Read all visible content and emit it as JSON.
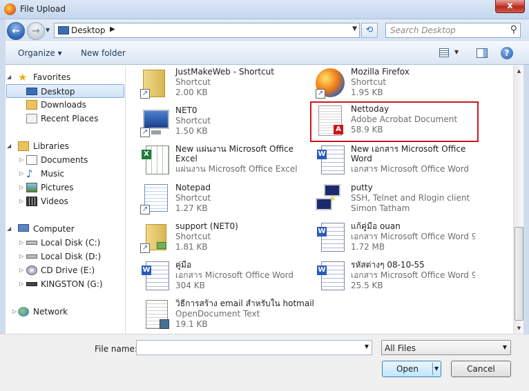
{
  "window": {
    "title": "File Upload",
    "close_glyph": "x"
  },
  "navbar": {
    "back_glyph": "←",
    "forward_glyph": "→",
    "breadcrumb": "Desktop",
    "search_placeholder": "Search Desktop"
  },
  "toolbar": {
    "organize": "Organize ▾",
    "new_folder": "New folder",
    "help": "?"
  },
  "nav": {
    "favorites": "Favorites",
    "desktop": "Desktop",
    "downloads": "Downloads",
    "recent": "Recent Places",
    "libraries": "Libraries",
    "documents": "Documents",
    "music": "Music",
    "pictures": "Pictures",
    "videos": "Videos",
    "computer": "Computer",
    "disk_c": "Local Disk (C:)",
    "disk_d": "Local Disk (D:)",
    "cd_e": "CD Drive (E:)",
    "kingston": "KINGSTON (G:)",
    "network": "Network"
  },
  "files": [
    {
      "name": "JustMakeWeb - Shortcut",
      "type": "Shortcut",
      "size": "2.00 KB"
    },
    {
      "name": "Mozilla Firefox",
      "type": "Shortcut",
      "size": "1.95 KB"
    },
    {
      "name": "NET0",
      "type": "Shortcut",
      "size": "1.50 KB"
    },
    {
      "name": "Nettoday",
      "type": "Adobe Acrobat Document",
      "size": "58.9 KB"
    },
    {
      "name": "New แผ่นงาน Microsoft Office Excel",
      "type": "แผ่นงาน Microsoft Office Excel",
      "size": ""
    },
    {
      "name": "New เอกสาร Microsoft Office Word",
      "type": "เอกสาร Microsoft Office Word",
      "size": ""
    },
    {
      "name": "Notepad",
      "type": "Shortcut",
      "size": "1.27 KB"
    },
    {
      "name": "putty",
      "type": "SSH, Telnet and Rlogin client",
      "size": "Simon Tatham"
    },
    {
      "name": "support (NET0)",
      "type": "Shortcut",
      "size": "1.81 KB"
    },
    {
      "name": "แก้คู่มือ ouan",
      "type": "เอกสาร Microsoft Office Word 9...",
      "size": "1.72 MB"
    },
    {
      "name": "คู่มือ",
      "type": "เอกสาร Microsoft Office Word",
      "size": "304 KB"
    },
    {
      "name": "รหัสต่างๆ 08-10-55",
      "type": "เอกสาร Microsoft Office Word 9...",
      "size": "25.5 KB"
    },
    {
      "name": "วิธีการสร้าง email สำหรับใน hotmail",
      "type": "OpenDocument Text",
      "size": "19.1 KB"
    }
  ],
  "bottom": {
    "file_name_label": "File name:",
    "file_name_value": "",
    "filter": "All Files",
    "open": "Open",
    "cancel": "Cancel"
  },
  "colors": {
    "highlight": "#d0151b",
    "selected_bg": "#cfe2f7"
  }
}
